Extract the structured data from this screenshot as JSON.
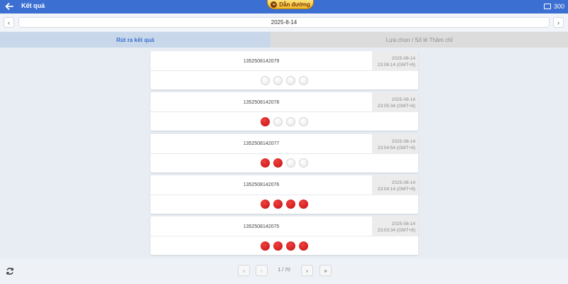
{
  "header": {
    "title": "Kết quả",
    "guide_label": "Dẫn đường",
    "balance": "300"
  },
  "datebar": {
    "prev_label": "‹",
    "next_label": "›",
    "date": "2025-8-14"
  },
  "tabs": [
    {
      "label": "Rút ra kết quả",
      "active": true
    },
    {
      "label": "Lựa chọn / Số lẻ Thâm chỉ",
      "active": false
    }
  ],
  "results": [
    {
      "issue": "1352508142079",
      "date": "2025-08-14",
      "time": "23:06:14 (GMT+8)",
      "balls": [
        "white",
        "white",
        "white",
        "white"
      ]
    },
    {
      "issue": "1352508142078",
      "date": "2025-08-14",
      "time": "23:05:34 (GMT+8)",
      "balls": [
        "red",
        "white",
        "white",
        "white"
      ]
    },
    {
      "issue": "1352508142077",
      "date": "2025-08-14",
      "time": "23:04:54 (GMT+8)",
      "balls": [
        "red",
        "red",
        "white",
        "white"
      ]
    },
    {
      "issue": "1352508142076",
      "date": "2025-08-14",
      "time": "23:04:14 (GMT+8)",
      "balls": [
        "red",
        "red",
        "red",
        "red"
      ]
    },
    {
      "issue": "1352508142075",
      "date": "2025-08-14",
      "time": "23:03:34 (GMT+8)",
      "balls": [
        "red",
        "red",
        "red",
        "red"
      ]
    }
  ],
  "pagination": {
    "first_label": "«",
    "prev_label": "‹",
    "page_info": "1 / 70",
    "next_label": "›",
    "last_label": "»"
  },
  "colors": {
    "header_bg": "#3b6fd1",
    "ball_red": "#d81b1b",
    "ball_white": "#f2f2f2",
    "active_tab_bg": "#c8d8ea"
  },
  "icons": {
    "back": "arrow-left-icon",
    "guide": "chevron-down-circle-icon",
    "wallet": "wallet-icon",
    "refresh": "refresh-icon"
  }
}
